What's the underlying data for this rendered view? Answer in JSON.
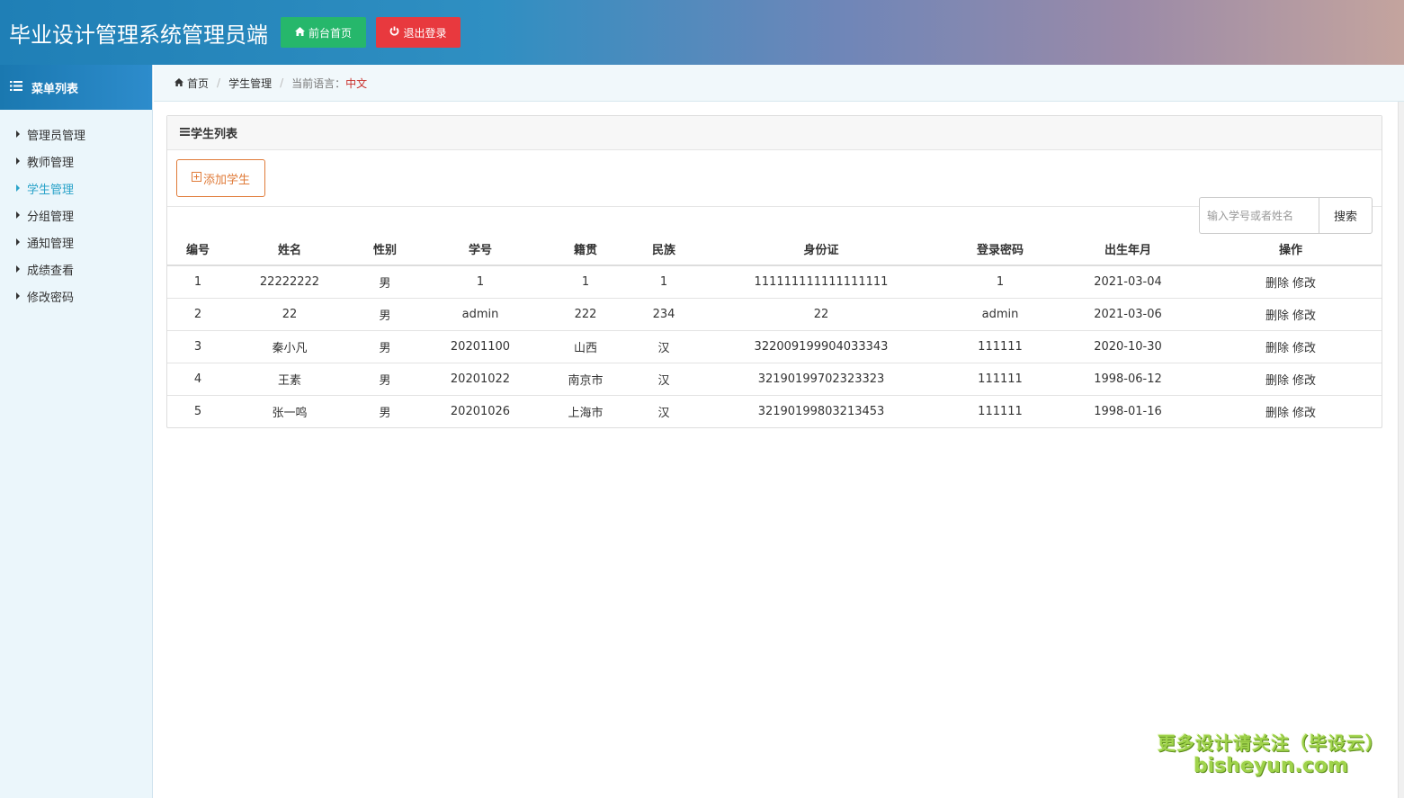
{
  "header": {
    "title": "毕业设计管理系统管理员端",
    "home_button": "前台首页",
    "logout_button": "退出登录"
  },
  "sidebar": {
    "heading": "菜单列表",
    "items": [
      {
        "label": "管理员管理",
        "active": false
      },
      {
        "label": "教师管理",
        "active": false
      },
      {
        "label": "学生管理",
        "active": true
      },
      {
        "label": "分组管理",
        "active": false
      },
      {
        "label": "通知管理",
        "active": false
      },
      {
        "label": "成绩查看",
        "active": false
      },
      {
        "label": "修改密码",
        "active": false
      }
    ]
  },
  "breadcrumb": {
    "home": "首页",
    "section": "学生管理",
    "lang_label": "当前语言：",
    "lang_value": "中文"
  },
  "panel": {
    "title": "学生列表",
    "add_button": "添加学生",
    "search_placeholder": "输入学号或者姓名",
    "search_button": "搜索"
  },
  "table": {
    "columns": [
      "编号",
      "姓名",
      "性别",
      "学号",
      "籍贯",
      "民族",
      "身份证",
      "登录密码",
      "出生年月",
      "操作"
    ],
    "rows": [
      [
        "1",
        "22222222",
        "男",
        "1",
        "1",
        "1",
        "111111111111111111",
        "1",
        "2021-03-04"
      ],
      [
        "2",
        "22",
        "男",
        "admin",
        "222",
        "234",
        "22",
        "admin",
        "2021-03-06"
      ],
      [
        "3",
        "秦小凡",
        "男",
        "20201100",
        "山西",
        "汉",
        "322009199904033343",
        "111111",
        "2020-10-30"
      ],
      [
        "4",
        "王素",
        "男",
        "20201022",
        "南京市",
        "汉",
        "32190199702323323",
        "111111",
        "1998-06-12"
      ],
      [
        "5",
        "张一鸣",
        "男",
        "20201026",
        "上海市",
        "汉",
        "32190199803213453",
        "111111",
        "1998-01-16"
      ]
    ],
    "delete_label": "删除",
    "edit_label": "修改"
  },
  "watermark": {
    "line1": "更多设计请关注（毕设云）",
    "line2": "bisheyun.com"
  },
  "colors": {
    "home_button": "#26b76b",
    "logout_button": "#e8393e",
    "add_button": "#e07b39",
    "active_menu": "#2aa3c9",
    "lang_value": "#c9302c"
  }
}
